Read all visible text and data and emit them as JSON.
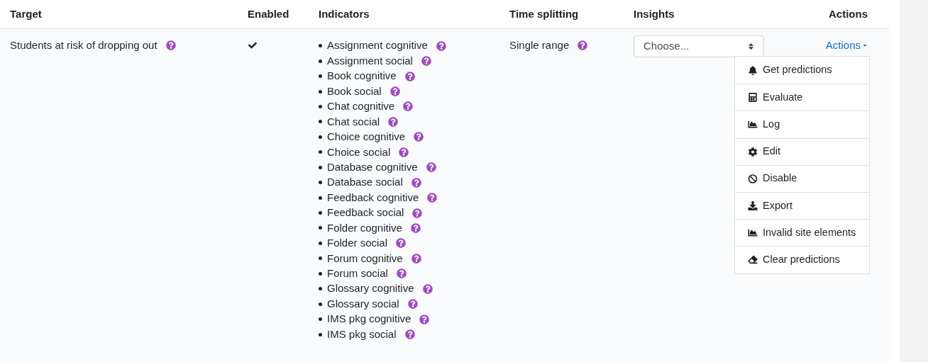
{
  "table": {
    "columns": [
      "Target",
      "Enabled",
      "Indicators",
      "Time splitting",
      "Insights",
      "Actions"
    ],
    "rows": [
      {
        "target": "Students at risk of dropping out",
        "enabled": true,
        "indicators": [
          "Assignment cognitive",
          "Assignment social",
          "Book cognitive",
          "Book social",
          "Chat cognitive",
          "Chat social",
          "Choice cognitive",
          "Choice social",
          "Database cognitive",
          "Database social",
          "Feedback cognitive",
          "Feedback social",
          "Folder cognitive",
          "Folder social",
          "Forum cognitive",
          "Forum social",
          "Glossary cognitive",
          "Glossary social",
          "IMS pkg cognitive",
          "IMS pkg social"
        ],
        "time_splitting": "Single range",
        "insights": {
          "placeholder": "Choose..."
        },
        "actions": {
          "label": "Actions",
          "expanded": true,
          "menu": [
            "Get predictions",
            "Evaluate",
            "Log",
            "Edit",
            "Disable",
            "Export",
            "Invalid site elements",
            "Clear predictions"
          ]
        }
      }
    ]
  }
}
